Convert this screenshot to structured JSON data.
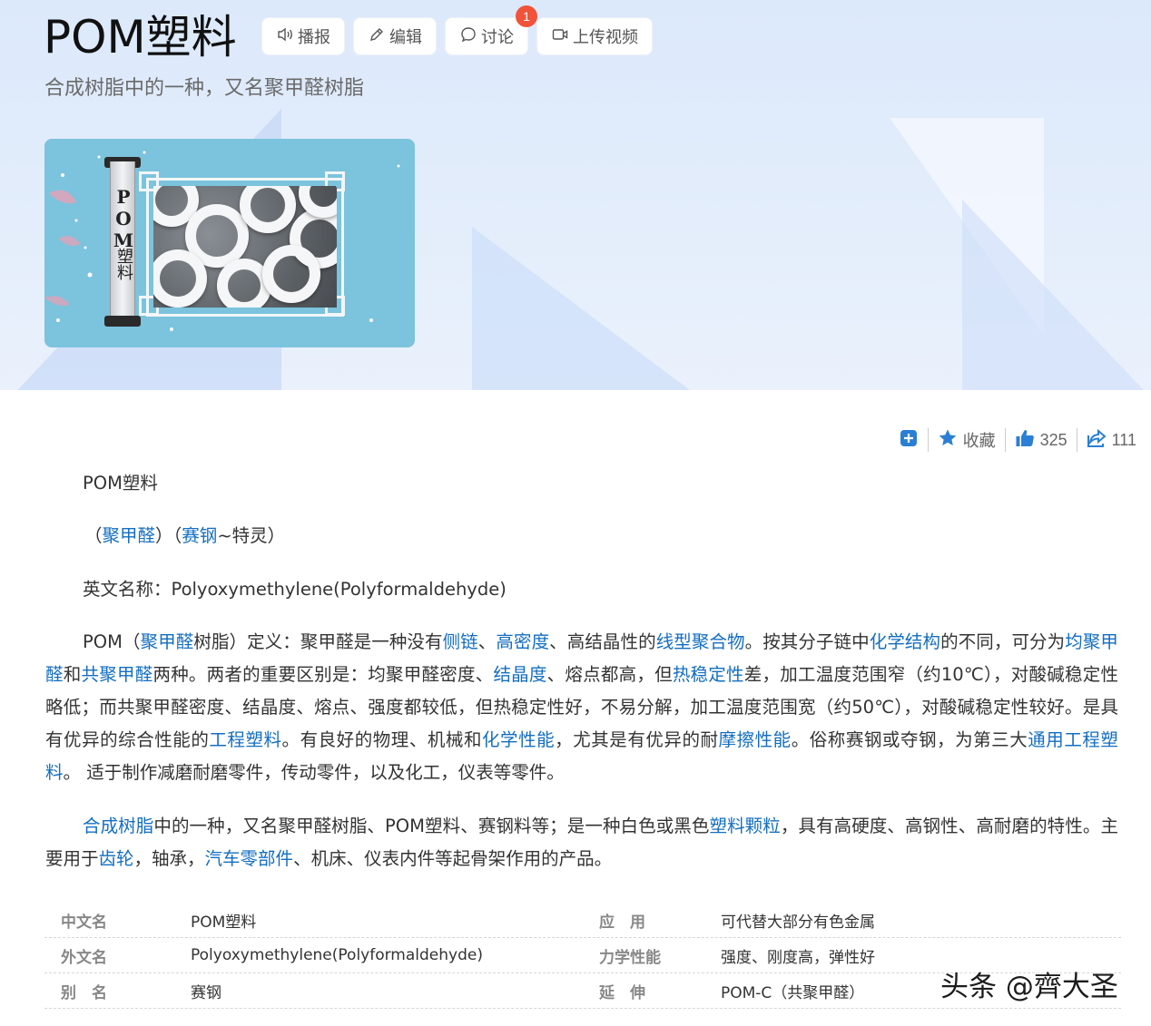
{
  "header": {
    "title": "POM塑料",
    "subtitle": "合成树脂中的一种，又名聚甲醛树脂",
    "buttons": {
      "broadcast": "播报",
      "edit": "编辑",
      "discuss": "讨论",
      "upload_video": "上传视频"
    },
    "discuss_badge": "1"
  },
  "image": {
    "scroll_latin": "POM",
    "scroll_cjk": "塑料"
  },
  "toolbar": {
    "favorite": "收藏",
    "likes": "325",
    "shares": "111"
  },
  "paragraphs": {
    "p1": "POM塑料",
    "p2": {
      "a": "（",
      "link1": "聚甲醛",
      "b": "）（",
      "link2": "赛钢",
      "c": "~特灵）"
    },
    "p3": "英文名称：Polyoxymethylene(Polyformaldehyde)",
    "p4": {
      "t1": "POM（",
      "l1": "聚甲醛",
      "t2": "树脂）定义：聚甲醛是一种没有",
      "l2": "侧链",
      "t3": "、",
      "l3": "高密度",
      "t4": "、高结晶性的",
      "l4": "线型聚合物",
      "t5": "。按其分子链中",
      "l5": "化学结构",
      "t6": "的不同，可分为",
      "l6": "均聚甲醛",
      "t7": "和",
      "l7": "共聚甲醛",
      "t8": "两种。两者的重要区别是：均聚甲醛密度、",
      "l8": "结晶度",
      "t9": "、熔点都高，但",
      "l9": "热稳定性",
      "t10": "差，加工温度范围窄（约10℃），对酸碱稳定性略低；而共聚甲醛密度、结晶度、熔点、强度都较低，但热稳定性好，不易分解，加工温度范围宽（约50℃），对酸碱稳定性较好。是具有优异的综合性能的",
      "l10": "工程塑料",
      "t11": "。有良好的物理、机械和",
      "l11": "化学性能",
      "t12": "，尤其是有优异的耐",
      "l12": "摩擦性能",
      "t13": "。俗称赛钢或夺钢，为第三大",
      "l13": "通用工程塑料",
      "t14": "。 适于制作减磨耐磨零件，传动零件，以及化工，仪表等零件。"
    },
    "p5": {
      "l1": "合成树脂",
      "t1": "中的一种，又名聚甲醛树脂、POM塑料、赛钢料等；是一种白色或黑色",
      "l2": "塑料颗粒",
      "t2": "，具有高硬度、高钢性、高耐磨的特性。主要用于",
      "l3": "齿轮",
      "t3": "，轴承，",
      "l4": "汽车零部件",
      "t4": "、机床、仪表内件等起骨架作用的产品。"
    }
  },
  "info_table": [
    {
      "k1": "中文名",
      "v1": "POM塑料",
      "k2": "应　用",
      "v2": "可代替大部分有色金属"
    },
    {
      "k1": "外文名",
      "v1": "Polyoxymethylene(Polyformaldehyde)",
      "k2": "力学性能",
      "v2": "强度、刚度高，弹性好"
    },
    {
      "k1": "别　名",
      "v1": "赛钢",
      "k2": "延　伸",
      "v2": "POM-C（共聚甲醛）"
    }
  ],
  "watermark": "头条 @齊大圣",
  "colors": {
    "link": "#136ec2",
    "banner_bg": "#dce9fb",
    "icon_blue": "#2a7fd4",
    "badge": "#f0533a"
  }
}
